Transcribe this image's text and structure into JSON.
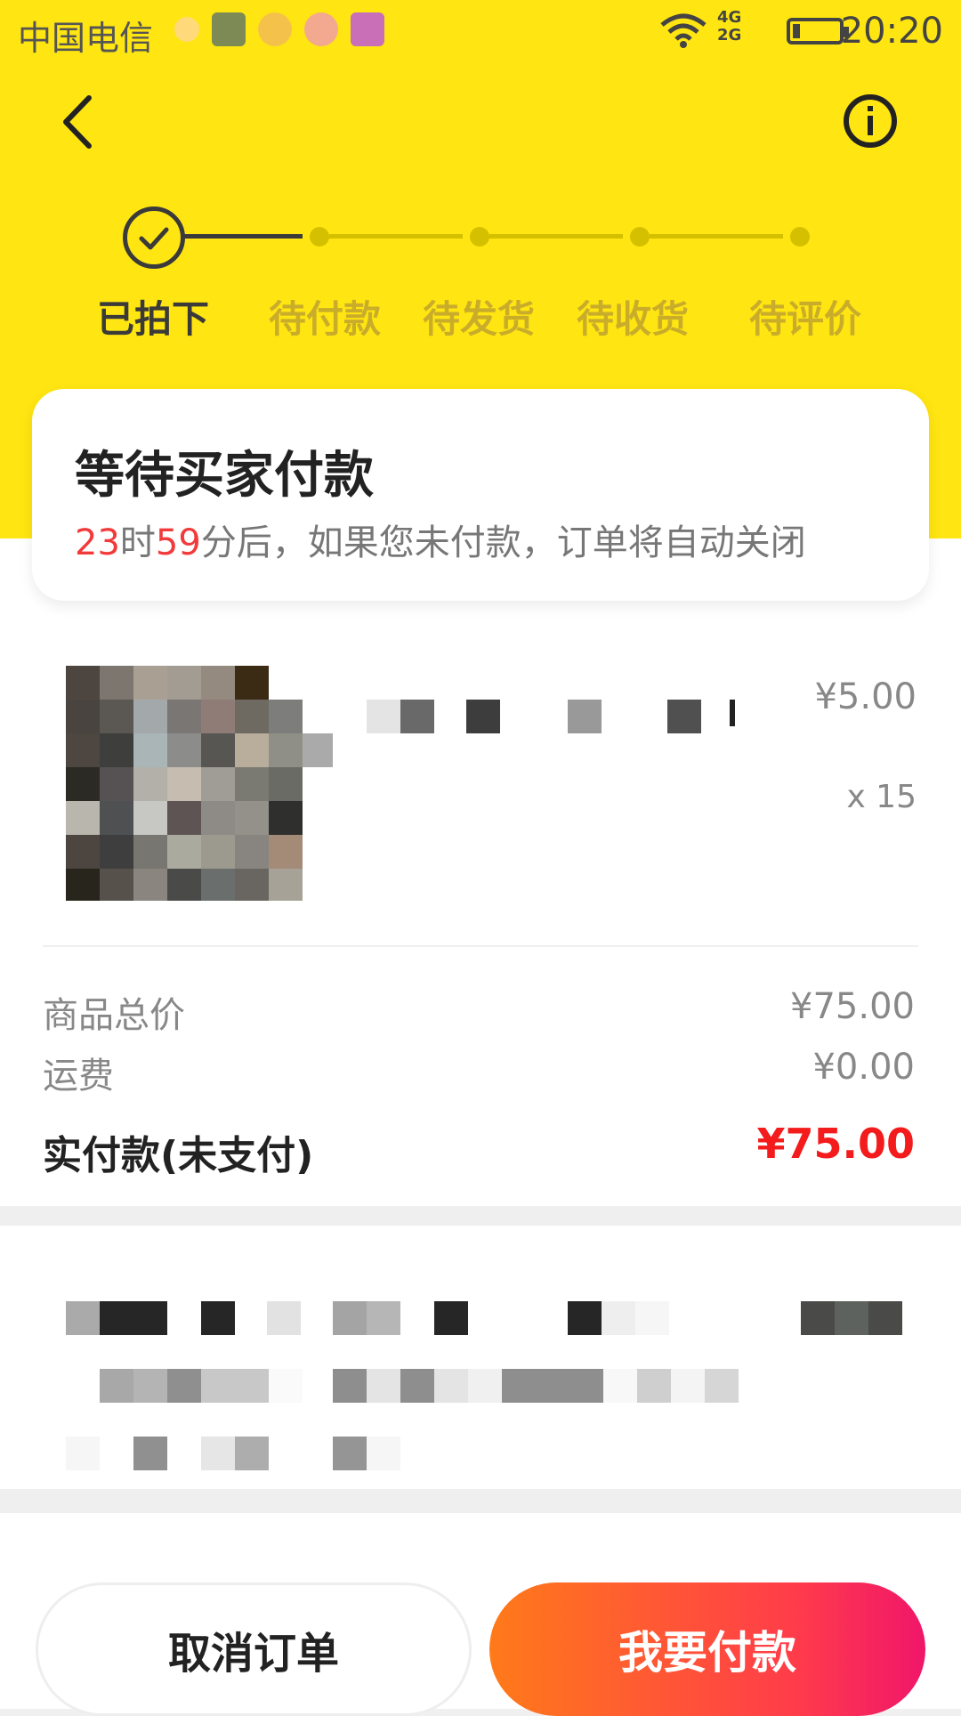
{
  "status_bar": {
    "carrier": "中国电信",
    "time": "20:20",
    "network": "4G\n2G"
  },
  "header": {
    "back_icon": "back-arrow-icon",
    "info_icon": "info-icon"
  },
  "progress_steps": [
    {
      "label": "已拍下",
      "state": "done"
    },
    {
      "label": "待付款",
      "state": "pending"
    },
    {
      "label": "待发货",
      "state": "pending"
    },
    {
      "label": "待收货",
      "state": "pending"
    },
    {
      "label": "待评价",
      "state": "pending"
    }
  ],
  "status_card": {
    "title": "等待买家付款",
    "hours": "23",
    "hours_unit": "时",
    "minutes": "59",
    "message": "分后，如果您未付款，订单将自动关闭"
  },
  "product": {
    "unit_price": "¥5.00",
    "quantity": "x 15"
  },
  "summary": {
    "goods_total_label": "商品总价",
    "goods_total_value": "¥75.00",
    "shipping_label": "运费",
    "shipping_value": "¥0.00",
    "paid_label": "实付款(未支付)",
    "paid_value": "¥75.00"
  },
  "actions": {
    "cancel_label": "取消订单",
    "pay_label": "我要付款"
  },
  "colors": {
    "brand_yellow": "#ffe511",
    "accent_red": "#f31b1b",
    "pay_gradient_start": "#ff7a1a",
    "pay_gradient_end": "#f0166a"
  }
}
